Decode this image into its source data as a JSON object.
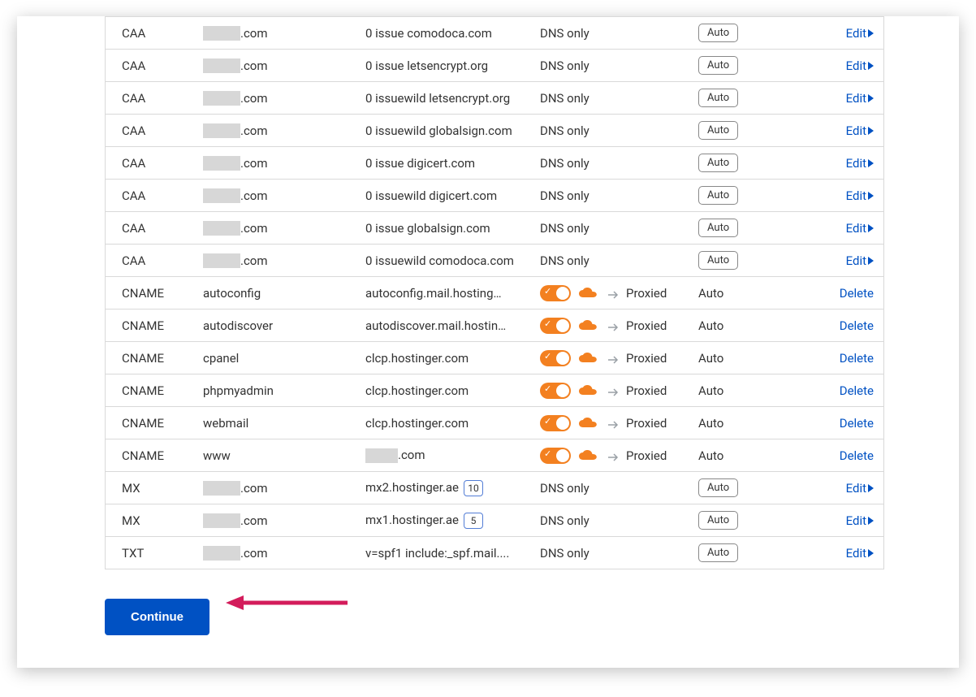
{
  "labels": {
    "edit": "Edit",
    "delete": "Delete",
    "auto": "Auto",
    "proxied": "Proxied",
    "dns_only": "DNS only",
    "continue": "Continue"
  },
  "records": [
    {
      "type": "CAA",
      "name_redacted": true,
      "name_suffix": ".com",
      "value": "0 issue comodoca.com",
      "proxy": "dns_only",
      "ttl_style": "button",
      "action": "edit"
    },
    {
      "type": "CAA",
      "name_redacted": true,
      "name_suffix": ".com",
      "value": "0 issue letsencrypt.org",
      "proxy": "dns_only",
      "ttl_style": "button",
      "action": "edit"
    },
    {
      "type": "CAA",
      "name_redacted": true,
      "name_suffix": ".com",
      "value": "0 issuewild letsencrypt.org",
      "proxy": "dns_only",
      "ttl_style": "button",
      "action": "edit"
    },
    {
      "type": "CAA",
      "name_redacted": true,
      "name_suffix": ".com",
      "value": "0 issuewild globalsign.com",
      "proxy": "dns_only",
      "ttl_style": "button",
      "action": "edit"
    },
    {
      "type": "CAA",
      "name_redacted": true,
      "name_suffix": ".com",
      "value": "0 issue digicert.com",
      "proxy": "dns_only",
      "ttl_style": "button",
      "action": "edit"
    },
    {
      "type": "CAA",
      "name_redacted": true,
      "name_suffix": ".com",
      "value": "0 issuewild digicert.com",
      "proxy": "dns_only",
      "ttl_style": "button",
      "action": "edit"
    },
    {
      "type": "CAA",
      "name_redacted": true,
      "name_suffix": ".com",
      "value": "0 issue globalsign.com",
      "proxy": "dns_only",
      "ttl_style": "button",
      "action": "edit"
    },
    {
      "type": "CAA",
      "name_redacted": true,
      "name_suffix": ".com",
      "value": "0 issuewild comodoca.com",
      "proxy": "dns_only",
      "ttl_style": "button",
      "action": "edit"
    },
    {
      "type": "CNAME",
      "name": "autoconfig",
      "value": "autoconfig.mail.hosting…",
      "proxy": "proxied",
      "ttl_style": "plain",
      "action": "delete"
    },
    {
      "type": "CNAME",
      "name": "autodiscover",
      "value": "autodiscover.mail.hostin…",
      "proxy": "proxied",
      "ttl_style": "plain",
      "action": "delete"
    },
    {
      "type": "CNAME",
      "name": "cpanel",
      "value": "clcp.hostinger.com",
      "proxy": "proxied",
      "ttl_style": "plain",
      "action": "delete"
    },
    {
      "type": "CNAME",
      "name": "phpmyadmin",
      "value": "clcp.hostinger.com",
      "proxy": "proxied",
      "ttl_style": "plain",
      "action": "delete"
    },
    {
      "type": "CNAME",
      "name": "webmail",
      "value": "clcp.hostinger.com",
      "proxy": "proxied",
      "ttl_style": "plain",
      "action": "delete"
    },
    {
      "type": "CNAME",
      "name": "www",
      "value_redacted": true,
      "value_suffix": ".com",
      "proxy": "proxied",
      "ttl_style": "plain",
      "action": "delete"
    },
    {
      "type": "MX",
      "name_redacted": true,
      "name_suffix": ".com",
      "value": "mx2.hostinger.ae",
      "priority": "10",
      "proxy": "dns_only",
      "ttl_style": "button",
      "action": "edit"
    },
    {
      "type": "MX",
      "name_redacted": true,
      "name_suffix": ".com",
      "value": "mx1.hostinger.ae",
      "priority": "5",
      "proxy": "dns_only",
      "ttl_style": "button",
      "action": "edit"
    },
    {
      "type": "TXT",
      "name_redacted": true,
      "name_suffix": ".com",
      "value": "v=spf1 include:_spf.mail....",
      "proxy": "dns_only",
      "ttl_style": "button",
      "action": "edit"
    }
  ]
}
